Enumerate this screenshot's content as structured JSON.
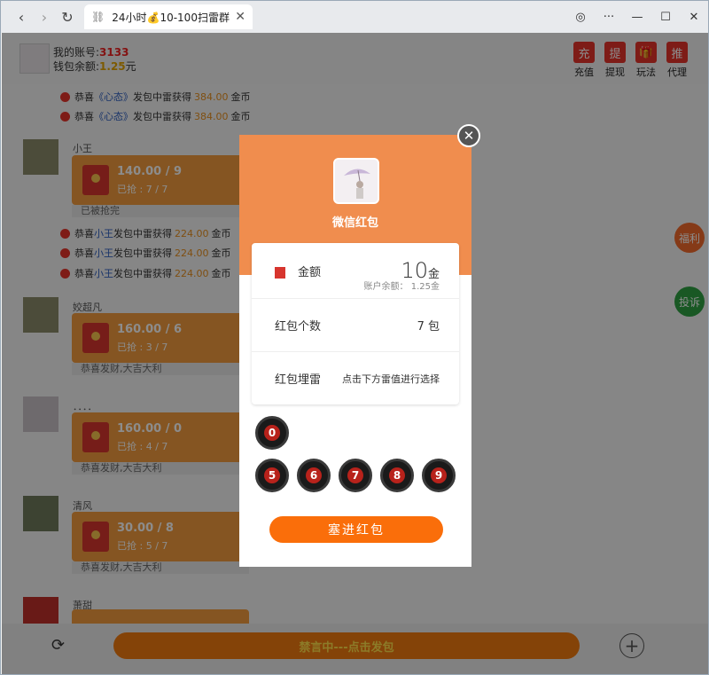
{
  "browser": {
    "tab_title": "24小时💰10-100扫雷群",
    "nav_back": "‹",
    "nav_forward": "›",
    "nav_reload": "↻",
    "tab_close": "✕",
    "win_globe": "◎",
    "win_more": "···",
    "win_min": "—",
    "win_max": "☐",
    "win_close": "✕"
  },
  "header": {
    "account_label": "我的账号:",
    "account_value": "3133",
    "balance_label": "钱包余额:",
    "balance_value": "1.25",
    "balance_unit": "元",
    "menu": [
      {
        "icon": "充",
        "label": "充值"
      },
      {
        "icon": "提",
        "label": "提现"
      },
      {
        "icon": "🎁",
        "label": "玩法"
      },
      {
        "icon": "推",
        "label": "代理"
      }
    ]
  },
  "feed": {
    "notices_top": [
      {
        "pre": "恭喜",
        "who": "《心态》",
        "mid": "发包中雷获得",
        "amt": "384.00",
        "post": "金币"
      },
      {
        "pre": "恭喜",
        "who": "《心态》",
        "mid": "发包中雷获得",
        "amt": "384.00",
        "post": "金币"
      }
    ],
    "messages": [
      {
        "nick": "小王",
        "amount": "140.00 / 9",
        "grab": "已抢 : 7 / 7",
        "tail": "已被抢完"
      },
      {
        "nick": "姣超凡",
        "amount": "160.00 / 6",
        "grab": "已抢 : 3 / 7",
        "tail": "恭喜发财,大吉大利"
      },
      {
        "nick": "．．．．",
        "amount": "160.00 / 0",
        "grab": "已抢 : 4 / 7",
        "tail": "恭喜发财,大吉大利"
      },
      {
        "nick": "清风",
        "amount": "30.00 / 8",
        "grab": "已抢 : 5 / 7",
        "tail": "恭喜发财,大吉大利"
      },
      {
        "nick": "萧甜"
      }
    ],
    "notices_mid": [
      {
        "pre": "恭喜",
        "who": "小王",
        "mid": "发包中雷获得",
        "amt": "224.00",
        "post": "金币"
      },
      {
        "pre": "恭喜",
        "who": "小王",
        "mid": "发包中雷获得",
        "amt": "224.00",
        "post": "金币"
      },
      {
        "pre": "恭喜",
        "who": "小王",
        "mid": "发包中雷获得",
        "amt": "224.00",
        "post": "金币"
      }
    ],
    "side_welfare": "福利",
    "side_complain": "投诉"
  },
  "footer": {
    "send_label": "禁言中---点击发包",
    "refresh_icon": "⟳",
    "plus_icon": "+"
  },
  "modal": {
    "title": "微信红包",
    "close_icon": "✕",
    "amount_label": "金额",
    "amount_value": "10",
    "amount_unit": "金",
    "account_balance": "账户余额： 1.25金",
    "count_label": "红包个数",
    "count_value": "7 包",
    "mine_label": "红包埋雷",
    "mine_hint": "点击下方雷值进行选择",
    "mines_row1": [
      "0"
    ],
    "mines_row2": [
      "5",
      "6",
      "7",
      "8",
      "9"
    ],
    "submit_label": "塞进红包"
  }
}
